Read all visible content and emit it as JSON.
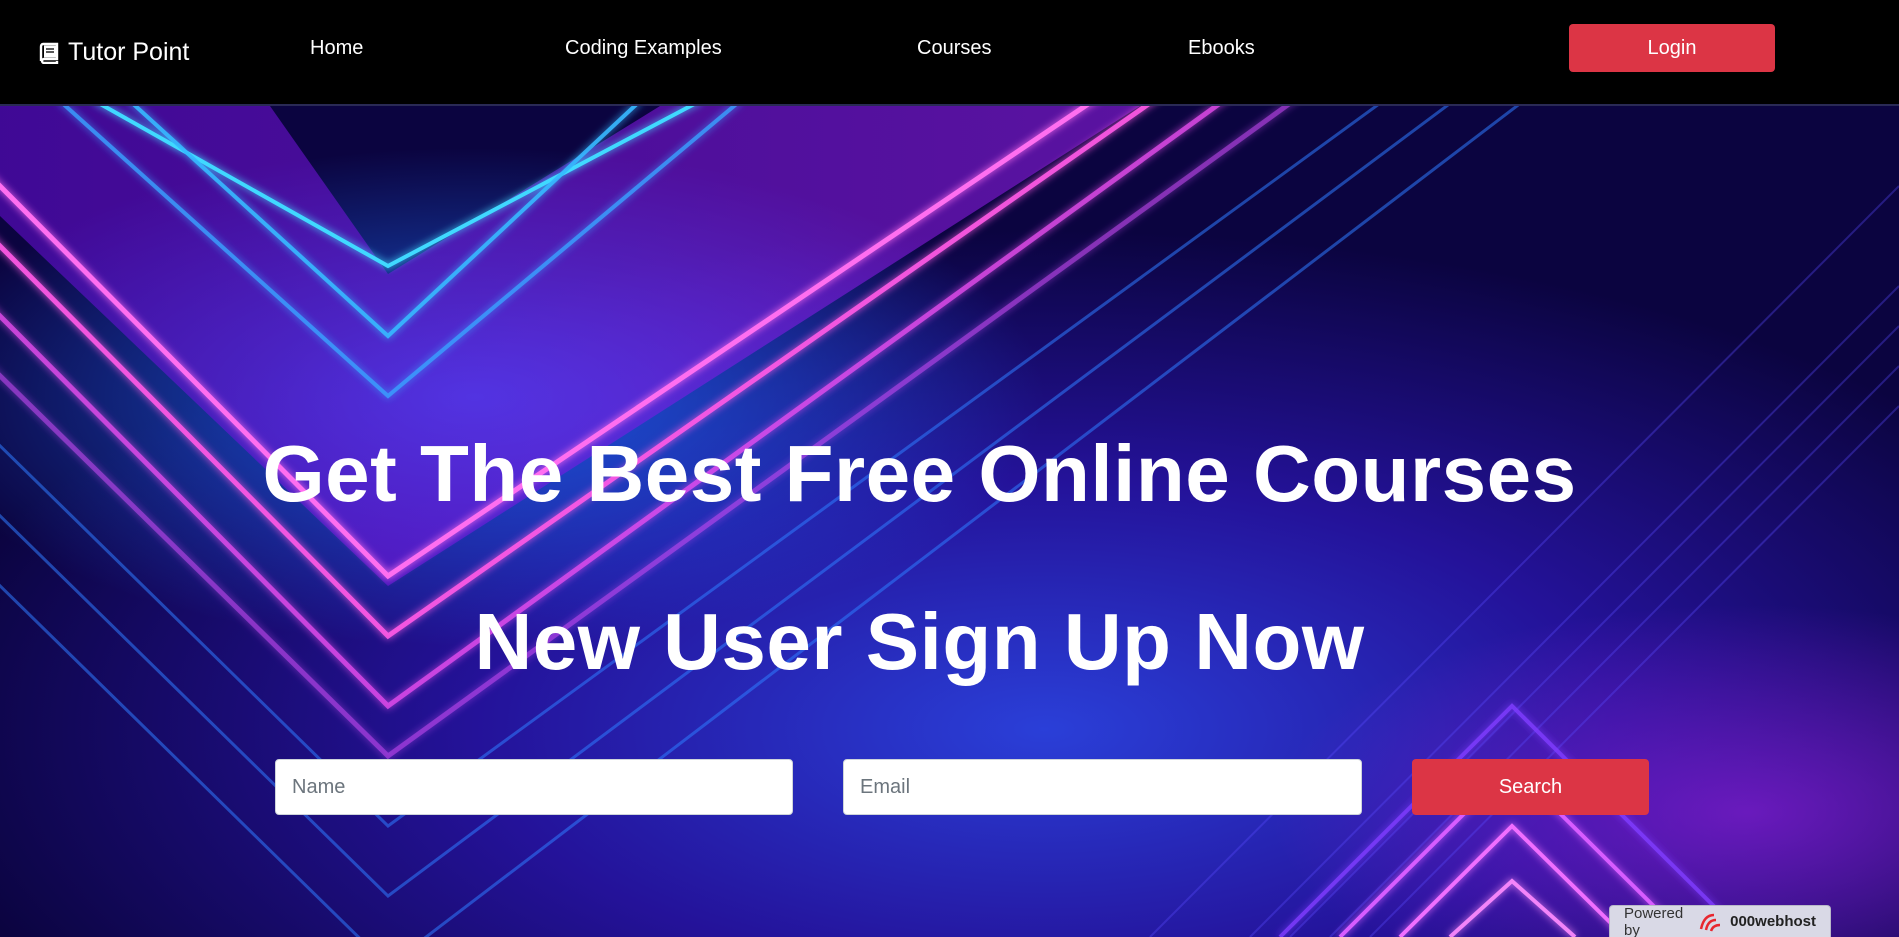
{
  "brand": {
    "name": "Tutor Point",
    "icon": "book-icon"
  },
  "nav": {
    "links": [
      "Home",
      "Coding Examples",
      "Courses",
      "Ebooks"
    ],
    "login_label": "Login"
  },
  "hero": {
    "headline": "Get The Best Free Online Courses",
    "subheadline": "New User Sign Up Now",
    "name_placeholder": "Name",
    "email_placeholder": "Email",
    "search_label": "Search"
  },
  "badge": {
    "prefix": "Powered by",
    "host": "000webhost",
    "icon": "000webhost-logo-icon"
  },
  "colors": {
    "accent": "#dc3545",
    "navbar": "#000000",
    "hero_base": "#0b0440"
  }
}
